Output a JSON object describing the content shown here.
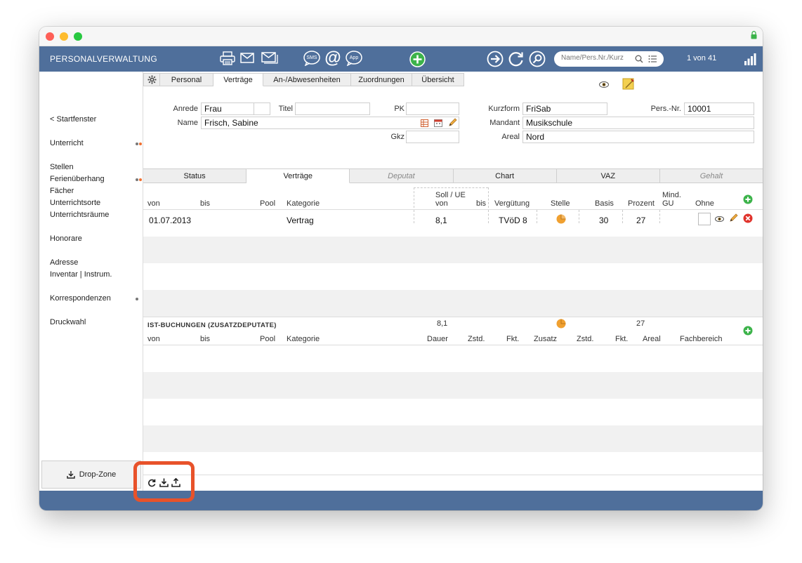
{
  "app": {
    "title": "PERSONALVERWALTUNG",
    "record_count": "1 von 41",
    "search_placeholder": "Name/Pers.Nr./Kurz"
  },
  "toolbar_icons": [
    "printer-icon",
    "mail-icon",
    "mail-batch-icon",
    "sms-icon",
    "at-icon",
    "app-icon",
    "add-icon",
    "arrow-right-icon",
    "refresh-icon",
    "search-icon",
    "signal-icon"
  ],
  "toolbar_labels": {
    "sms": "SMS",
    "app": "App",
    "at": "@"
  },
  "sidebar": {
    "items": [
      {
        "label": "< Startfenster"
      },
      {
        "label": "Unterricht"
      },
      {
        "label": "Stellen"
      },
      {
        "label": "Ferienüberhang"
      },
      {
        "label": "Fächer"
      },
      {
        "label": "Unterrichtsorte"
      },
      {
        "label": "Unterrichtsräume"
      },
      {
        "label": "Honorare"
      },
      {
        "label": "Adresse"
      },
      {
        "label": "Inventar | Instrum."
      },
      {
        "label": "Korrespondenzen"
      },
      {
        "label": "Druckwahl"
      }
    ],
    "dropzone_label": "Drop-Zone"
  },
  "tabs": [
    "Personal",
    "Verträge",
    "An-/Abwesenheiten",
    "Zuordnungen",
    "Übersicht"
  ],
  "form": {
    "anrede_label": "Anrede",
    "anrede": "Frau",
    "titel_label": "Titel",
    "titel": "",
    "pk_label": "PK",
    "pk": "",
    "name_label": "Name",
    "name": "Frisch, Sabine",
    "gkz_label": "Gkz",
    "gkz": "",
    "kurzform_label": "Kurzform",
    "kurzform": "FriSab",
    "persnr_label": "Pers.-Nr.",
    "persnr": "10001",
    "mandant_label": "Mandant",
    "mandant": "Musikschule",
    "areal_label": "Areal",
    "areal": "Nord"
  },
  "subtabs": [
    "Status",
    "Verträge",
    "Deputat",
    "Chart",
    "VAZ",
    "Gehalt"
  ],
  "contracts": {
    "headers": {
      "von": "von",
      "bis": "bis",
      "pool": "Pool",
      "kategorie": "Kategorie",
      "soll_ue": "Soll / UE",
      "soll_von": "von",
      "soll_bis": "bis",
      "verguetung": "Vergütung",
      "stelle": "Stelle",
      "basis": "Basis",
      "prozent": "Prozent",
      "mind_gu": "Mind.\nGU",
      "ohne": "Ohne"
    },
    "rows": [
      {
        "von": "01.07.2013",
        "kategorie": "Vertrag",
        "soll_von": "8,1",
        "verguetung": "TVöD 8",
        "basis": "30",
        "prozent": "27"
      }
    ]
  },
  "ist": {
    "title": "IST-BUCHUNGEN (ZUSATZDEPUTATE)",
    "sum_value": "8,1",
    "sum_prozent": "27",
    "headers": {
      "von": "von",
      "bis": "bis",
      "pool": "Pool",
      "kategorie": "Kategorie",
      "dauer": "Dauer",
      "zstd": "Zstd.",
      "fkt": "Fkt.",
      "zusatz": "Zusatz",
      "zstd2": "Zstd.",
      "fkt2": "Fkt.",
      "areal": "Areal",
      "fachbereich": "Fachbereich"
    }
  },
  "colors": {
    "toolbar": "#4f6f9b",
    "accent_green": "#3cb34a",
    "delete_red": "#e0322b",
    "highlight": "#e8522a",
    "pie_orange": "#f0a030"
  }
}
